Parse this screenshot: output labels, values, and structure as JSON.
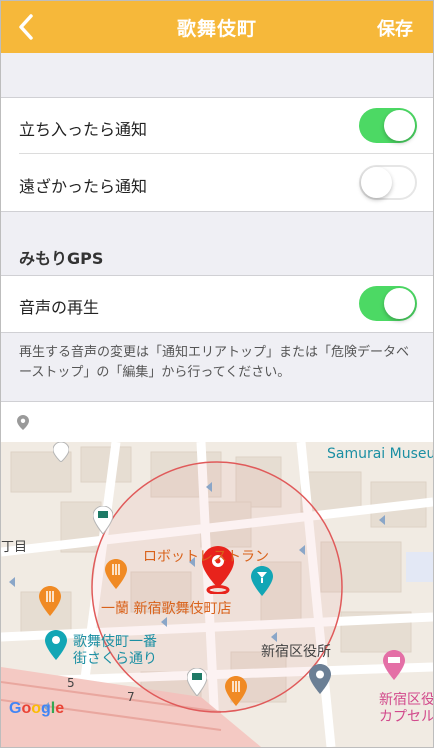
{
  "nav": {
    "title": "歌舞伎町",
    "save_label": "保存",
    "back_icon": "chevron-left-icon"
  },
  "colors": {
    "accent": "#f6b83a",
    "toggle_on": "#4cd964",
    "geofence": "#e05a5a",
    "pin": "#e8231c"
  },
  "notifications": {
    "enter": {
      "label": "立ち入ったら通知",
      "enabled": true
    },
    "leave": {
      "label": "遠ざかったら通知",
      "enabled": false
    }
  },
  "gps_section": {
    "header": "みもりGPS",
    "sound": {
      "label": "音声の再生",
      "enabled": true
    },
    "note": "再生する音声の変更は「通知エリアトップ」または「危険データベーストップ」の「編集」から行ってください。"
  },
  "location_row": {
    "icon": "location-pin-icon",
    "value": ""
  },
  "map": {
    "labels": {
      "samurai": "Samurai Museu",
      "robot": "ロボットレストラン",
      "ichiran": "一蘭 新宿歌舞伎町店",
      "kabuki_street_1": "歌舞伎町一番",
      "kabuki_street_2": "街さくら通り",
      "ward_office": "新宿区役所",
      "capsule_1": "新宿区役",
      "capsule_2": "カプセル",
      "chome": "丁目",
      "num5": "5",
      "num7": "7"
    },
    "google": "Google"
  }
}
